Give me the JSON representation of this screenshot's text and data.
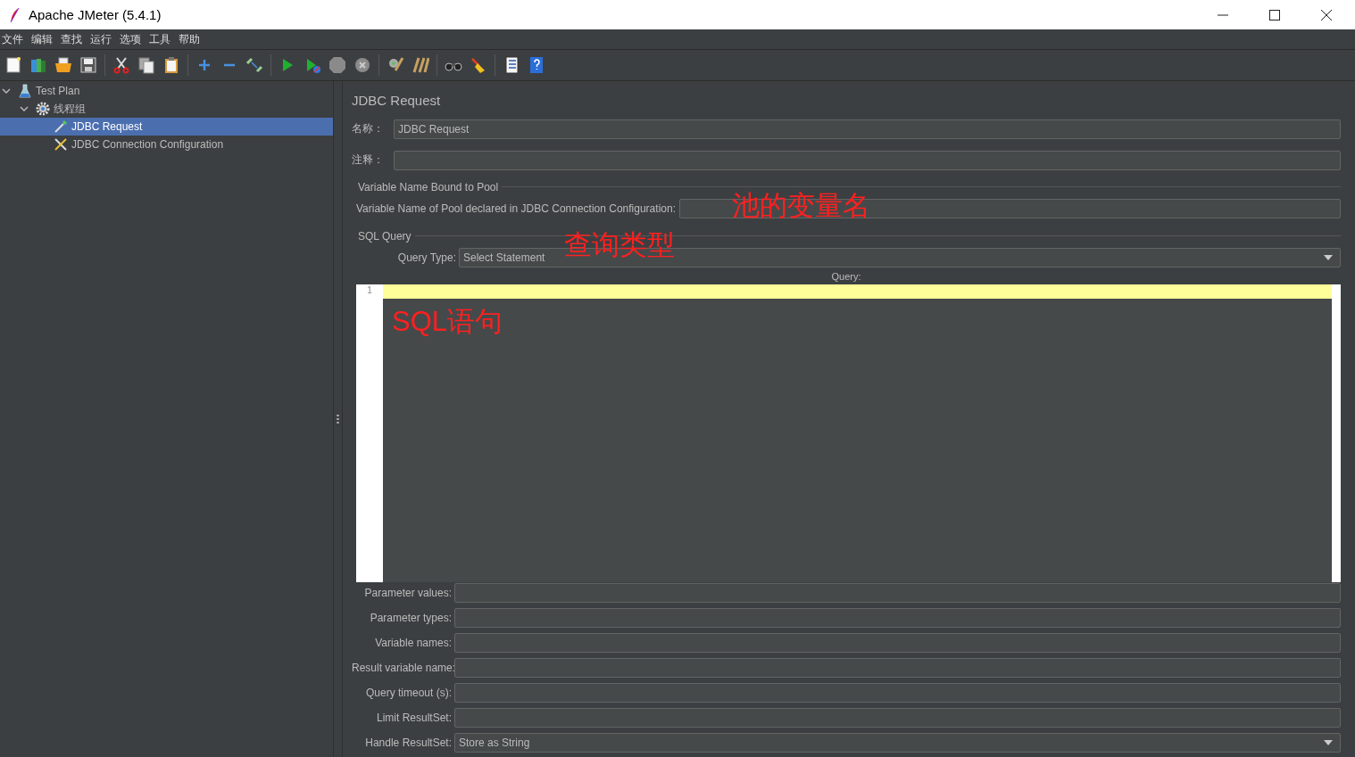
{
  "window": {
    "title": "Apache JMeter (5.4.1)"
  },
  "menu": [
    "文件",
    "编辑",
    "查找",
    "运行",
    "选项",
    "工具",
    "帮助"
  ],
  "tree": [
    {
      "label": "Test Plan",
      "kind": "plan",
      "expanded": true,
      "selected": false,
      "children": [
        {
          "label": "线程组",
          "kind": "thread-group",
          "expanded": true,
          "selected": false,
          "children": [
            {
              "label": "JDBC Request",
              "kind": "sampler",
              "selected": true
            },
            {
              "label": "JDBC Connection Configuration",
              "kind": "config",
              "selected": false
            }
          ]
        }
      ]
    }
  ],
  "panel": {
    "title": "JDBC Request",
    "name_label": "名称：",
    "name_value": "JDBC Request",
    "comment_label": "注释：",
    "pool_section": "Variable Name Bound to Pool",
    "pool_label": "Variable Name of Pool declared in JDBC Connection Configuration:",
    "pool_annotation": "池的变量名",
    "sql_section": "SQL Query",
    "query_type_label": "Query Type:",
    "query_type": "Select Statement",
    "query_type_annotation": "查询类型",
    "query_label": "Query:",
    "line_numbers": [
      "1"
    ],
    "query_annotation": "SQL语句",
    "fields": [
      {
        "label": "Parameter values:",
        "kind": "text"
      },
      {
        "label": "Parameter types:",
        "kind": "text"
      },
      {
        "label": "Variable names:",
        "kind": "text"
      },
      {
        "label": "Result variable name:",
        "kind": "text"
      },
      {
        "label": "Query timeout (s):",
        "kind": "text"
      },
      {
        "label": "Limit ResultSet:",
        "kind": "text"
      },
      {
        "label": "Handle ResultSet:",
        "kind": "select",
        "value": "Store as String"
      }
    ]
  }
}
